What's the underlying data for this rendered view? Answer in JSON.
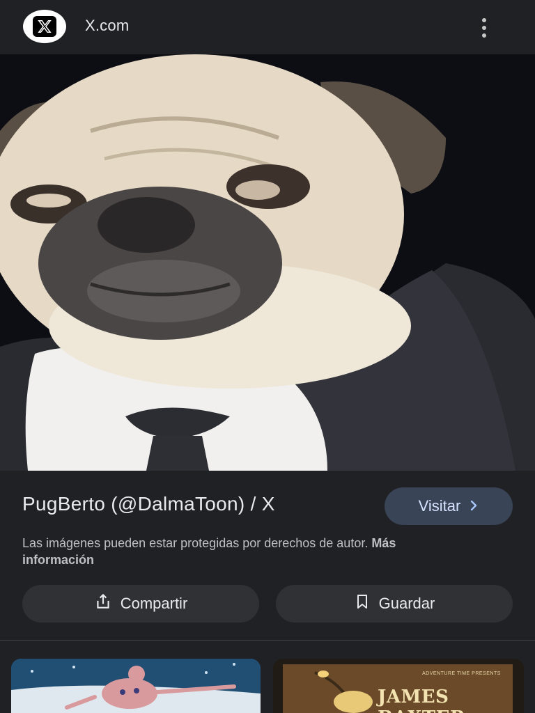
{
  "header": {
    "site_name": "X.com",
    "logo_icon": "x-logo-icon",
    "menu_icon": "more-vert-icon"
  },
  "result": {
    "title": "PugBerto (@DalmaToon) / X",
    "visit_label": "Visitar",
    "copyright_text": "Las imágenes pueden estar protegidas por derechos de autor.",
    "copyright_link": "Más información"
  },
  "actions": {
    "share_label": "Compartir",
    "save_label": "Guardar"
  },
  "related": {
    "right_thumb_title": "JAMES BAXTER",
    "right_thumb_sub": "ADVENTURE TIME PRESENTS"
  },
  "colors": {
    "background": "#202124",
    "visit_button": "#394457",
    "action_button": "#303134"
  }
}
